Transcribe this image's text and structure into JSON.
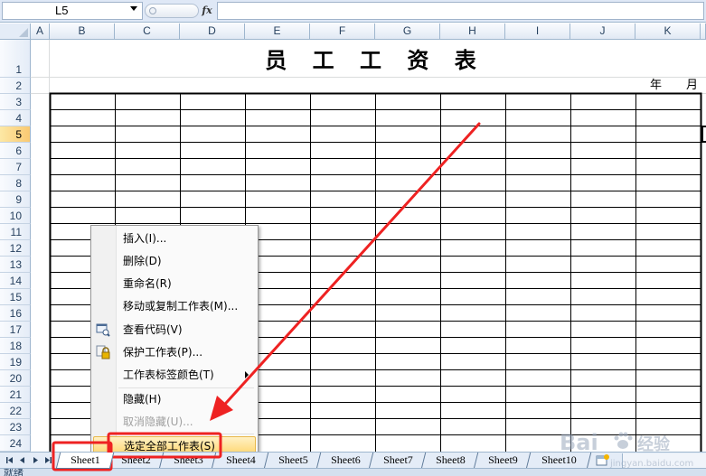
{
  "formula_bar": {
    "name_box": "L5",
    "fx_label": "fx",
    "formula": ""
  },
  "grid": {
    "columns": [
      "A",
      "B",
      "C",
      "D",
      "E",
      "F",
      "G",
      "H",
      "I",
      "J",
      "K"
    ],
    "rows": [
      "1",
      "2",
      "3",
      "4",
      "5",
      "6",
      "7",
      "8",
      "9",
      "10",
      "11",
      "12",
      "13",
      "14",
      "15",
      "16",
      "17",
      "18",
      "19",
      "20",
      "21",
      "22",
      "23",
      "24"
    ],
    "selected_row": "5",
    "title": "员 工 工 资 表",
    "date_year": "年",
    "date_month": "月"
  },
  "context_menu": {
    "items": [
      {
        "label": "插入(I)..."
      },
      {
        "label": "删除(D)"
      },
      {
        "label": "重命名(R)"
      },
      {
        "label": "移动或复制工作表(M)..."
      },
      {
        "label": "查看代码(V)",
        "icon": "view-code-icon"
      },
      {
        "label": "保护工作表(P)...",
        "icon": "lock-icon"
      },
      {
        "label": "工作表标签颜色(T)"
      },
      {
        "label": "隐藏(H)"
      },
      {
        "label": "取消隐藏(U)..."
      },
      {
        "label": "选定全部工作表(S)"
      }
    ],
    "highlighted_item": "选定全部工作表(S)"
  },
  "sheet_tabs": [
    "Sheet1",
    "Sheet2",
    "Sheet3",
    "Sheet4",
    "Sheet5",
    "Sheet6",
    "Sheet7",
    "Sheet8",
    "Sheet9",
    "Sheet10"
  ],
  "active_tab": "Sheet1",
  "status_bar": {
    "text": "就绪"
  },
  "colors": {
    "annotation_red": "#ee2222",
    "menu_highlight": "#ffd56b",
    "header_blue": "#dfe8f6"
  }
}
